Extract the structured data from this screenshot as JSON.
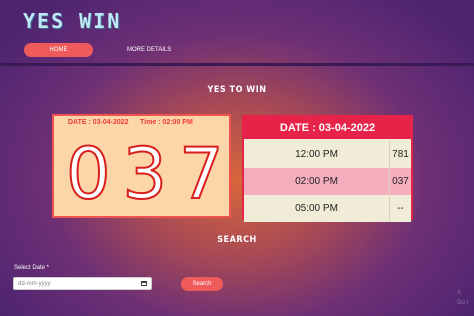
{
  "brand": "YES WIN",
  "nav": {
    "home": "HOME",
    "more": "MORE DETAILS"
  },
  "section_title": "YES TO WIN",
  "result": {
    "date": "DATE : 03-04-2022",
    "time": "Time : 02:00 PM",
    "number": "037"
  },
  "table": {
    "header": "DATE : 03-04-2022",
    "rows": [
      {
        "time": "12:00 PM",
        "value": "781"
      },
      {
        "time": "02:00 PM",
        "value": "037"
      },
      {
        "time": "05:00 PM",
        "value": "--"
      }
    ]
  },
  "search": {
    "title": "SEARCH",
    "label": "Select Date *",
    "placeholder": "dd-mm-yyyy",
    "button": "Search"
  },
  "watermark": [
    "A",
    "Go t"
  ],
  "colors": {
    "accent": "#ef5b5b",
    "table_header": "#e8234a",
    "highlight_row": "#f4aebe",
    "result_bg": "#fcd6a8",
    "brand_text": "#bfe7f5"
  },
  "icons": [
    "calendar-icon"
  ]
}
